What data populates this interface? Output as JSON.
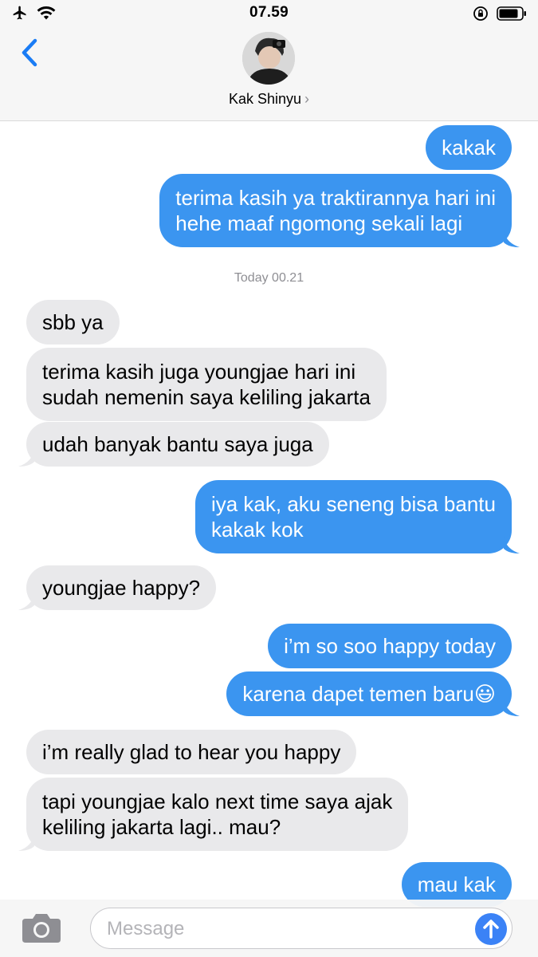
{
  "status_bar": {
    "time": "07.59",
    "left_icons": [
      "airplane-icon",
      "wifi-icon"
    ],
    "right_icons": [
      "orientation-lock-icon",
      "battery-icon"
    ]
  },
  "header": {
    "back_icon": "chevron-left-icon",
    "contact_name": "Kak Shinyu",
    "contact_chevron": "›"
  },
  "timestamp": "Today 00.21",
  "messages": [
    {
      "direction": "outgoing",
      "text": "kakak"
    },
    {
      "direction": "outgoing",
      "lines": [
        "terima kasih ya traktirannya hari ini",
        "hehe maaf ngomong sekali lagi"
      ]
    },
    {
      "direction": "incoming",
      "text": "sbb ya"
    },
    {
      "direction": "incoming",
      "lines": [
        "terima kasih juga youngjae hari ini",
        "sudah nemenin saya keliling jakarta"
      ]
    },
    {
      "direction": "incoming",
      "text": "udah banyak bantu saya juga"
    },
    {
      "direction": "outgoing",
      "lines": [
        "iya kak, aku seneng bisa bantu",
        "kakak kok"
      ]
    },
    {
      "direction": "incoming",
      "text": "youngjae happy?"
    },
    {
      "direction": "outgoing",
      "text": "i’m so soo happy today"
    },
    {
      "direction": "outgoing",
      "text": "karena dapet temen baru😃"
    },
    {
      "direction": "incoming",
      "text": "i’m really glad to hear you happy"
    },
    {
      "direction": "incoming",
      "lines": [
        "tapi youngjae kalo next time saya ajak",
        "keliling jakarta lagi.. mau?"
      ]
    },
    {
      "direction": "outgoing",
      "text": "mau kak"
    }
  ],
  "input_bar": {
    "camera_icon": "camera-icon",
    "placeholder": "Message",
    "send_icon": "arrow-up-icon"
  },
  "colors": {
    "outgoing_bubble": "#3b95f0",
    "incoming_bubble": "#e9e9eb",
    "accent": "#3b82f6"
  }
}
